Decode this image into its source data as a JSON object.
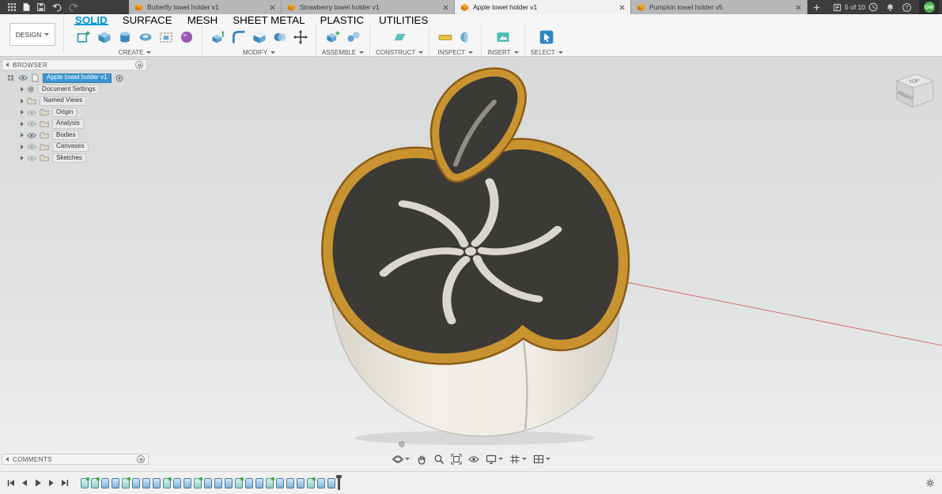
{
  "titlebar": {
    "document_tabs": [
      {
        "title": "Butterfly towel holder v1"
      },
      {
        "title": "Strawberry towel holder v1"
      },
      {
        "title": "Apple towel holder v1"
      },
      {
        "title": "Pumpkin towel holder v5"
      }
    ],
    "active_tab": "Apple towel holder v1",
    "job_status": "5 of 10",
    "help_glyph": "?",
    "avatar_initials": "GM"
  },
  "ribbon": {
    "workspace_button": "DESIGN",
    "tabs": [
      {
        "label": "SOLID"
      },
      {
        "label": "SURFACE"
      },
      {
        "label": "MESH"
      },
      {
        "label": "SHEET METAL"
      },
      {
        "label": "PLASTIC"
      },
      {
        "label": "UTILITIES"
      }
    ],
    "groups": [
      {
        "label": "CREATE"
      },
      {
        "label": "MODIFY"
      },
      {
        "label": "ASSEMBLE"
      },
      {
        "label": "CONSTRUCT"
      },
      {
        "label": "INSPECT"
      },
      {
        "label": "INSERT"
      },
      {
        "label": "SELECT"
      }
    ]
  },
  "browser": {
    "title": "BROWSER",
    "root_item": "Apple towel holder v1",
    "items": [
      {
        "label": "Document Settings"
      },
      {
        "label": "Named Views"
      },
      {
        "label": "Origin"
      },
      {
        "label": "Analysis"
      },
      {
        "label": "Bodies"
      },
      {
        "label": "Canvases"
      },
      {
        "label": "Sketches"
      }
    ]
  },
  "viewcube": {
    "top": "TOP",
    "front": "FRONT"
  },
  "comments": {
    "title": "COMMENTS"
  },
  "timeline": {
    "features": [
      "sketch",
      "sketch",
      "feature",
      "feature",
      "sketch",
      "feature",
      "feature",
      "feature",
      "sketch",
      "feature",
      "feature",
      "sketch",
      "feature",
      "feature",
      "feature",
      "sketch",
      "feature",
      "feature",
      "sketch",
      "feature",
      "feature",
      "feature",
      "sketch",
      "feature",
      "feature"
    ]
  },
  "colors": {
    "selection_blue": "#3b97d3",
    "accent_blue": "#0696d7",
    "model_rim_tan": "#c9932f",
    "model_top_dark": "#3b3a37",
    "model_body_cream": "#edebe4",
    "axis_red": "#c0392b"
  }
}
